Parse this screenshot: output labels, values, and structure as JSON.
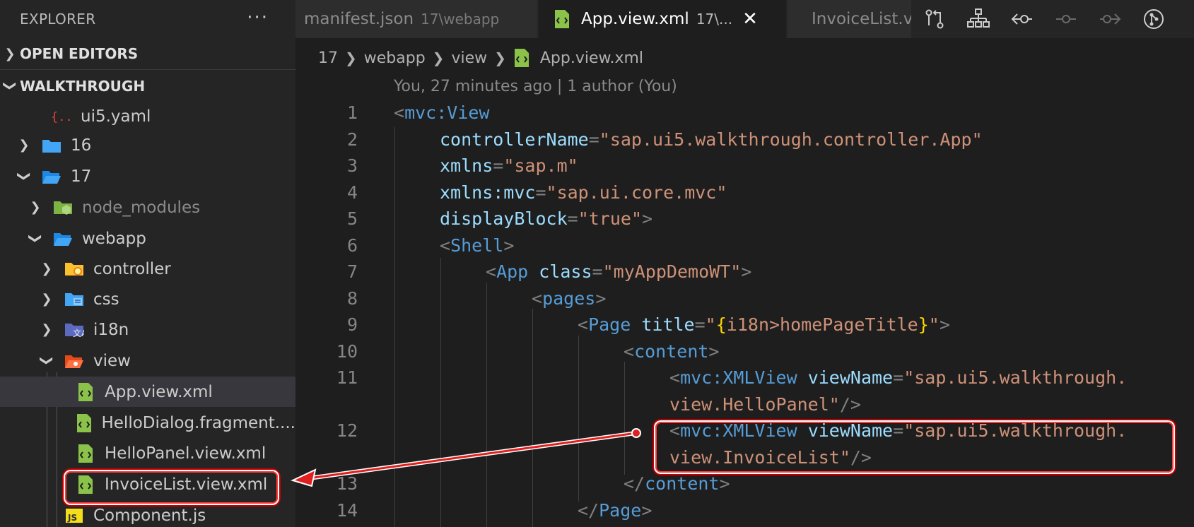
{
  "explorer": {
    "title": "EXPLORER",
    "more": "···",
    "open_editors": "OPEN EDITORS",
    "workspace": "WALKTHROUGH",
    "items": [
      {
        "label": "ui5.yaml",
        "icon": "yaml-file-icon"
      },
      {
        "label": "16",
        "icon": "folder-icon"
      },
      {
        "label": "17",
        "icon": "folder-open-icon"
      },
      {
        "label": "node_modules",
        "icon": "node-modules-folder-icon"
      },
      {
        "label": "webapp",
        "icon": "folder-open-icon"
      },
      {
        "label": "controller",
        "icon": "controller-folder-icon"
      },
      {
        "label": "css",
        "icon": "css-folder-icon"
      },
      {
        "label": "i18n",
        "icon": "i18n-folder-icon"
      },
      {
        "label": "view",
        "icon": "view-folder-open-icon"
      },
      {
        "label": "App.view.xml",
        "icon": "xml-file-icon"
      },
      {
        "label": "HelloDialog.fragment....",
        "icon": "xml-file-icon"
      },
      {
        "label": "HelloPanel.view.xml",
        "icon": "xml-file-icon"
      },
      {
        "label": "InvoiceList.view.xml",
        "icon": "xml-file-icon"
      },
      {
        "label": "Component.js",
        "icon": "js-file-icon"
      }
    ]
  },
  "tabs": [
    {
      "label": "manifest.json",
      "path": "17\\webapp"
    },
    {
      "label": "App.view.xml",
      "path": "17\\...",
      "close": "✕"
    },
    {
      "label": "InvoiceList.v"
    }
  ],
  "breadcrumb": [
    "17",
    "webapp",
    "view",
    "App.view.xml"
  ],
  "blame": "You, 27 minutes ago | 1 author (You)",
  "line_numbers": [
    "1",
    "2",
    "3",
    "4",
    "5",
    "6",
    "7",
    "8",
    "9",
    "10",
    "11",
    "12",
    "13",
    "14"
  ],
  "code": {
    "l1_tag": "mvc:View",
    "l2_attr": "controllerName",
    "l2_val": "\"sap.ui5.walkthrough.controller.App\"",
    "l3_attr": "xmlns",
    "l3_val": "\"sap.m\"",
    "l4_attr": "xmlns:mvc",
    "l4_val": "\"sap.ui.core.mvc\"",
    "l5_attr": "displayBlock",
    "l5_val": "\"true\"",
    "l6_tag": "Shell",
    "l7_tag": "App",
    "l7_attr": "class",
    "l7_val": "\"myAppDemoWT\"",
    "l8_tag": "pages",
    "l9_tag": "Page",
    "l9_attr": "title",
    "l9_val_a": "\"",
    "l9_brace_open": "{",
    "l9_val_b": "i18n>homePageTitle",
    "l9_brace_close": "}",
    "l9_val_c": "\"",
    "l10_tag": "content",
    "l11_tag": "mvc:XMLView",
    "l11_attr": "viewName",
    "l11_val_a": "\"sap.ui5.walkthrough.",
    "l11_val_b": "view.HelloPanel\"",
    "l12_tag": "mvc:XMLView",
    "l12_attr": "viewName",
    "l12_val_a": "\"sap.ui5.walkthrough.",
    "l12_val_b": "view.InvoiceList\"",
    "l13_tag": "content",
    "l14_tag": "Page"
  },
  "colors": {
    "tag": "#569cd6",
    "attr": "#9cdcfe",
    "string": "#ce9178",
    "callout": "#ff3b3b"
  }
}
